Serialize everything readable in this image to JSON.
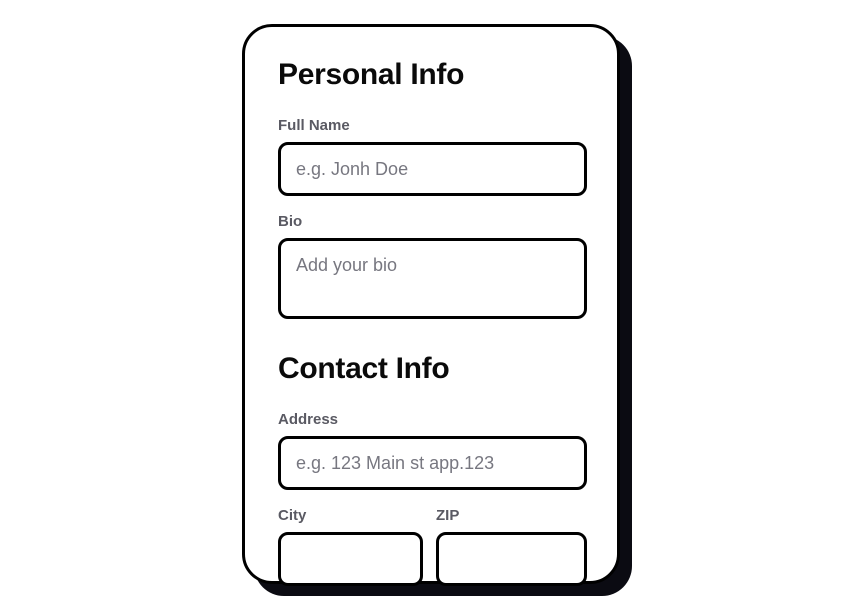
{
  "personal": {
    "title": "Personal Info",
    "full_name": {
      "label": "Full Name",
      "placeholder": "e.g. Jonh Doe",
      "value": ""
    },
    "bio": {
      "label": "Bio",
      "placeholder": "Add your bio",
      "value": ""
    }
  },
  "contact": {
    "title": "Contact Info",
    "address": {
      "label": "Address",
      "placeholder": "e.g. 123 Main st app.123",
      "value": ""
    },
    "city": {
      "label": "City",
      "placeholder": "",
      "value": ""
    },
    "zip": {
      "label": "ZIP",
      "placeholder": "",
      "value": ""
    }
  },
  "colors": {
    "border": "#000000",
    "shadow": "#0b0b12",
    "label": "#5a5a63",
    "placeholder": "#777780",
    "heading": "#0a0a0a"
  }
}
